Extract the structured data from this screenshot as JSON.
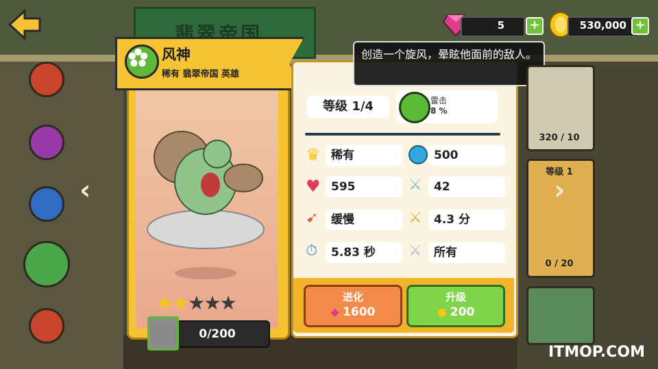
{
  "header": {
    "faction_tab": "翡翠帝国",
    "gems": "5",
    "coins": "530,000"
  },
  "hero": {
    "name": "风神",
    "subtitle": "稀有 翡翠帝国 英雄",
    "shards": "0/200",
    "stars_filled": 2,
    "stars_total": 5
  },
  "tooltip": {
    "text": "创造一个旋风，晕眩他面前的敌人。"
  },
  "stats": {
    "level": "等级 1/4",
    "skill_name": "雷击",
    "skill_value": "8 %",
    "rarity": "稀有",
    "cost": "500",
    "health": "595",
    "attack": "42",
    "speed": "缓慢",
    "attack_speed": "4.3 分",
    "time": "5.83 秒",
    "targets": "所有"
  },
  "actions": {
    "evolve_label": "进化",
    "evolve_cost": "1600",
    "upgrade_label": "升级",
    "upgrade_cost": "200"
  },
  "right_cards": {
    "card1_progress": "320 / 10",
    "card2_level": "等级 1",
    "card2_progress": "0 / 20"
  },
  "watermark": "ITMOP.COM",
  "colors": {
    "gold": "#f6c332",
    "green": "#7fd44a",
    "orange": "#f28a4a"
  }
}
